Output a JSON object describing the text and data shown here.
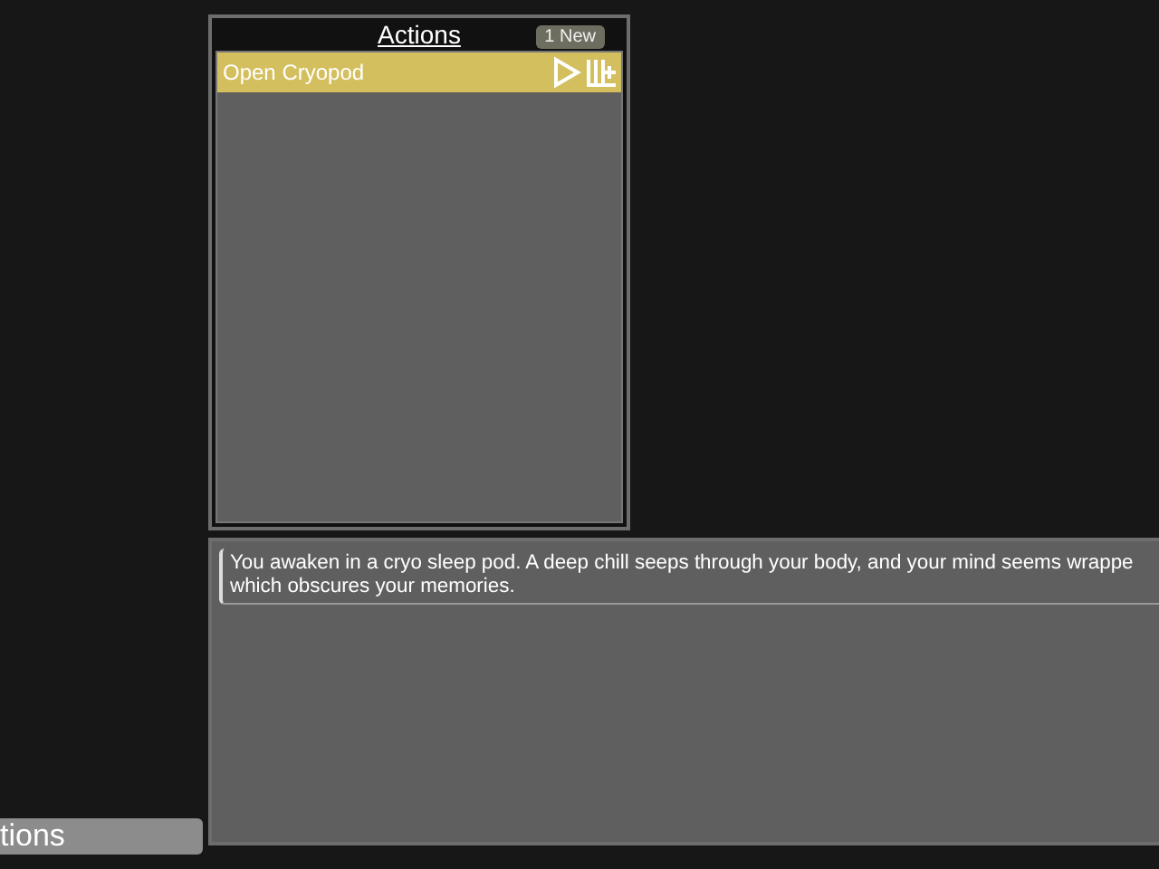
{
  "actions_panel": {
    "title": "Actions",
    "badge": "1 New",
    "items": [
      {
        "label": "Open Cryopod",
        "selected": true
      }
    ]
  },
  "story_panel": {
    "entries": [
      "You awaken in a cryo sleep pod. A deep chill seeps through your body, and your mind seems wrappe\nwhich obscures your memories."
    ]
  },
  "side_button": {
    "label": "tions"
  }
}
